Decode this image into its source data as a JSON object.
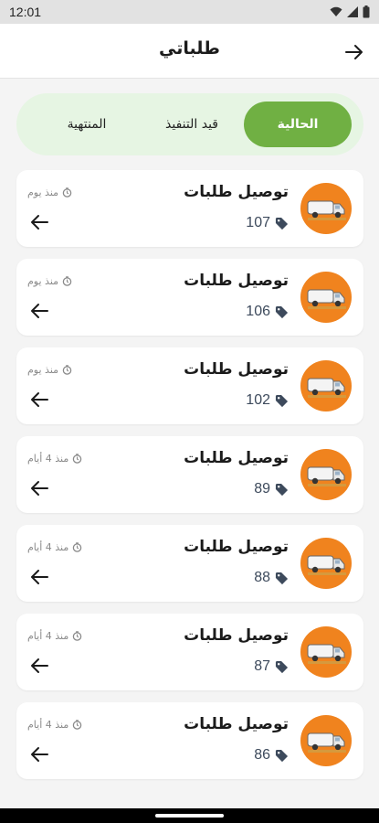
{
  "status_bar": {
    "time": "12:01"
  },
  "header": {
    "title": "طلباتي"
  },
  "tabs": [
    {
      "label": "الحالية",
      "active": true
    },
    {
      "label": "قيد التنفيذ",
      "active": false
    },
    {
      "label": "المنتهية",
      "active": false
    }
  ],
  "orders": [
    {
      "title": "توصيل طلبات",
      "number": "107",
      "time": "منذ يوم"
    },
    {
      "title": "توصيل طلبات",
      "number": "106",
      "time": "منذ يوم"
    },
    {
      "title": "توصيل طلبات",
      "number": "102",
      "time": "منذ يوم"
    },
    {
      "title": "توصيل طلبات",
      "number": "89",
      "time": "منذ 4 أيام"
    },
    {
      "title": "توصيل طلبات",
      "number": "88",
      "time": "منذ 4 أيام"
    },
    {
      "title": "توصيل طلبات",
      "number": "87",
      "time": "منذ 4 أيام"
    },
    {
      "title": "توصيل طلبات",
      "number": "86",
      "time": "منذ 4 أيام"
    }
  ],
  "colors": {
    "accent": "#70b043",
    "tab_bg": "#e6f5e3",
    "avatar": "#f0831e"
  },
  "icons": {
    "back": "arrow-right-icon",
    "open": "arrow-left-icon",
    "tag": "tag-icon",
    "clock": "clock-icon",
    "avatar": "van-icon"
  }
}
